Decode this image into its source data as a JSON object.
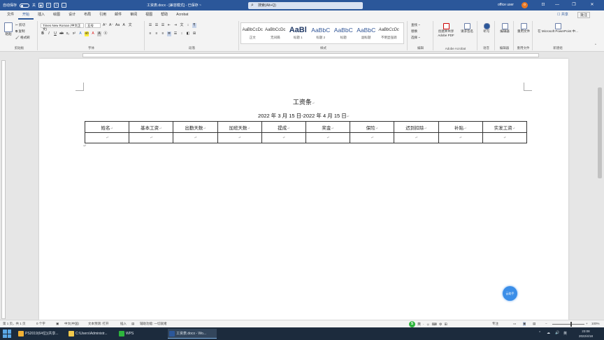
{
  "titlebar": {
    "autosave_label": "自动保存",
    "autosave_state": "关",
    "doc_title": "工资表.docx - [兼容模式] - 已保存 ~",
    "search_placeholder": "搜索(Alt+Q)",
    "user_name": "office user",
    "avatar_initial": "o",
    "minimize": "—",
    "restore": "❐",
    "close": "✕",
    "ribbon_display": "⊡"
  },
  "menubar": {
    "tabs": [
      "文件",
      "开始",
      "插入",
      "绘图",
      "设计",
      "布局",
      "引用",
      "邮件",
      "审阅",
      "视图",
      "帮助",
      "Acrobat"
    ],
    "active_tab": "开始",
    "share": "☐ 共享",
    "comments": "批注"
  },
  "ribbon": {
    "clipboard": {
      "name": "剪贴板",
      "paste": "粘贴",
      "cut": "✂ 剪切",
      "copy": "⧉ 复制",
      "format_painter": "🖌 格式刷"
    },
    "font": {
      "name": "字体",
      "font_name": "Times New Roman (中文正文)",
      "font_size": "五号",
      "row1": [
        "A⁺",
        "A⁻",
        "Aa",
        "A",
        "文"
      ],
      "row2": [
        "B",
        "I",
        "U",
        "ab",
        "x₂",
        "x²",
        "A",
        "ab",
        "A",
        "A",
        "Ⓐ"
      ]
    },
    "paragraph": {
      "name": "段落",
      "row1": [
        "☰",
        "☰",
        "☰",
        "⇤",
        "⇥",
        "文",
        "↕",
        "¶"
      ],
      "row2": [
        "≡",
        "≡",
        "≡",
        "≣",
        "☰",
        "↕",
        "◧",
        "⊞"
      ]
    },
    "styles": {
      "name": "样式",
      "items": [
        {
          "sample": "AaBbCcDc",
          "name": "正文"
        },
        {
          "sample": "AaBbCcDc",
          "name": "无间隔"
        },
        {
          "sample": "AaBl",
          "name": "标题 1"
        },
        {
          "sample": "AaBbC",
          "name": "标题 2"
        },
        {
          "sample": "AaBbC",
          "name": "标题"
        },
        {
          "sample": "AaBbC",
          "name": "副标题"
        },
        {
          "sample": "AaBbCcDc",
          "name": "不明显强调"
        }
      ]
    },
    "editing": {
      "name": "编辑",
      "find": "查找 ~",
      "replace": "替换",
      "select": "选择 ~"
    },
    "adobe": {
      "name": "Adobe Acrobat",
      "create_pdf": "创建并共享 Adobe PDF",
      "request_sign": "请求签名"
    },
    "voice": {
      "name": "语音",
      "dictate": "听写"
    },
    "sensitivity": {
      "name": "编辑器",
      "editor": "编辑器"
    },
    "reuse": {
      "name": "重用文件",
      "reuse_files": "重用文件"
    },
    "powerpoint": {
      "name": "新建组",
      "label": "在 Microsoft PowerPoint 中..."
    }
  },
  "document": {
    "heading": "工资条",
    "subtitle": "2022 年 3 月 15 日-2022 年 4 月 15 日",
    "return_mark": "↵",
    "table_headers": [
      "姓名",
      "基本工资",
      "出勤天数",
      "加班天数",
      "提成",
      "奖金",
      "保险",
      "迟到扣除",
      "补贴",
      "实发工资"
    ]
  },
  "fab": {
    "label": "云助手"
  },
  "statusbar": {
    "page": "第 1 页，共 1 页",
    "words": "0 个字",
    "lang": "中文(中国)",
    "text_predictions": "文本预测: 打开",
    "insert_mode": "插入",
    "accessibility": "辅助功能: 一切就绪",
    "focus": "专注",
    "zoom": "100%"
  },
  "ime": {
    "logo": "S",
    "items": [
      "英",
      "·",
      "☺",
      "⌨",
      "⚙",
      "⊞"
    ]
  },
  "taskbar": {
    "items": [
      {
        "label": "PS2019(64位)(共享...",
        "color": "#f2b134"
      },
      {
        "label": "C:\\Users\\Administr...",
        "color": "#f2c94c"
      },
      {
        "label": "WPS",
        "color": "#2db53d"
      },
      {
        "label": "工资表.docx - Wo...",
        "color": "#2b579a"
      }
    ],
    "clock_time": "23:08",
    "clock_date": "2022/4/18",
    "tray": [
      "⌃",
      "☁",
      "🔊",
      "英"
    ]
  }
}
